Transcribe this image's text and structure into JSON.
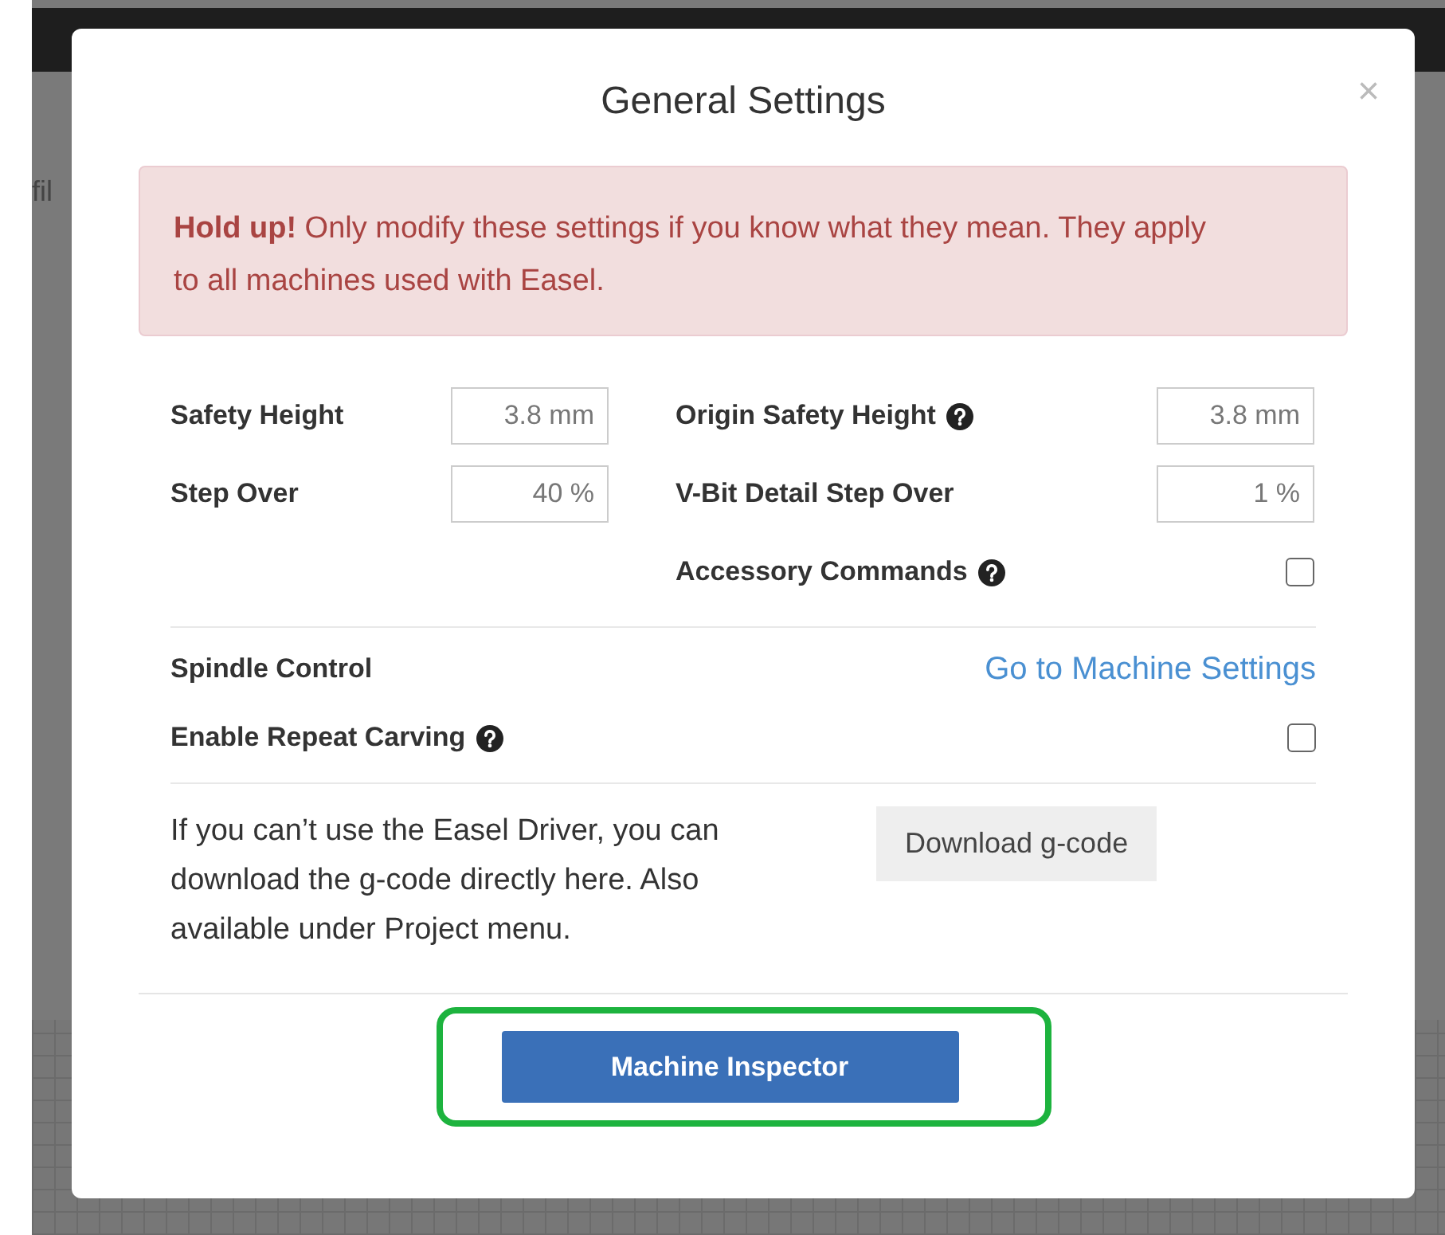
{
  "backdrop": {
    "toolbar_text": "fil"
  },
  "dialog": {
    "title": "General Settings",
    "close": "×"
  },
  "alert": {
    "text": "**Hold up!** Only modify these settings if you know what they mean. They apply to all machines used with Easel."
  },
  "settings_left": [
    {
      "label": "Safety Height",
      "value": "3.8 mm"
    },
    {
      "label": "Step Over",
      "value": "40 %"
    }
  ],
  "settings_right": [
    {
      "kind": "input",
      "label": "Origin Safety Height",
      "help": true,
      "value": "3.8 mm"
    },
    {
      "kind": "input",
      "label": "V-Bit Detail Step Over",
      "help": false,
      "value": "1 %"
    },
    {
      "kind": "checkbox",
      "label": "Accessory Commands",
      "help": true,
      "checked": false
    }
  ],
  "spindle": {
    "label": "Spindle Control",
    "link": "Go to Machine Settings"
  },
  "repeat": {
    "label": "Enable Repeat Carving",
    "help": true,
    "checked": false
  },
  "download": {
    "text": "If you can’t use the Easel Driver, you can download the g-code directly here. Also available under Project menu.",
    "button": "Download g-code"
  },
  "footer": {
    "button": "Machine Inspector",
    "highlighted": true
  }
}
